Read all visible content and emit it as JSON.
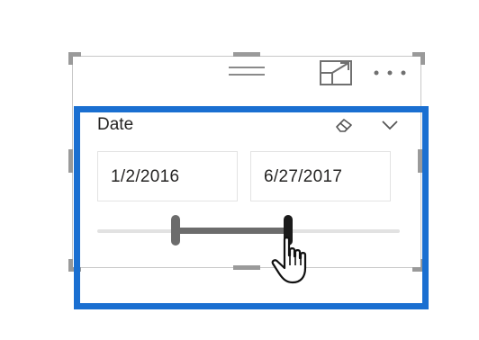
{
  "slicer": {
    "title": "Date",
    "start_date": "1/2/2016",
    "end_date": "6/27/2017",
    "range_start_fraction": 0.26,
    "range_end_fraction": 0.63
  },
  "header_icons": {
    "drag": "drag-handle-icon",
    "focus": "focus-mode-icon",
    "more": "more-options-icon"
  },
  "slicer_icons": {
    "clear": "eraser-icon",
    "expand": "chevron-down-icon"
  },
  "colors": {
    "selection_border": "#1a6fd1",
    "range_fill": "#6c6c6c",
    "track": "#e2e2e2"
  }
}
